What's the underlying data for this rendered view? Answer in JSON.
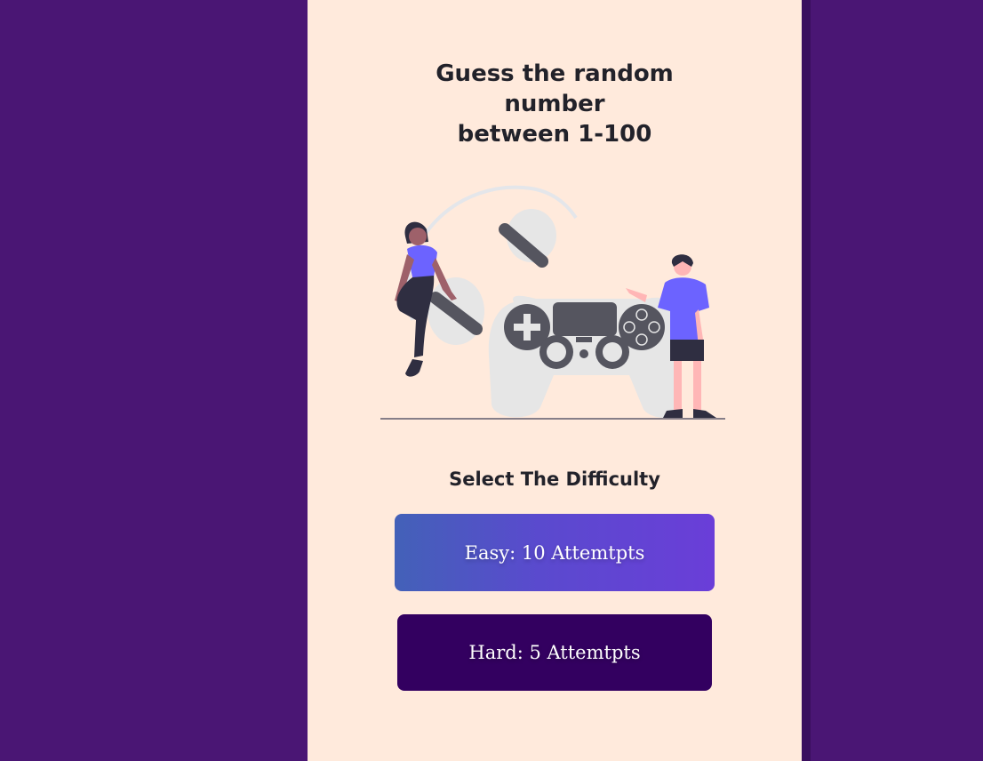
{
  "title_lines": [
    "Guess the random",
    "number",
    "between 1-100"
  ],
  "illustration": {
    "name": "gaming-illustration",
    "colors": {
      "accent": "#6c63ff",
      "controller": "#e6e6e6",
      "controller_dark": "#55555f",
      "skin": "#ffb6b6",
      "dark": "#2f2e41"
    }
  },
  "difficulty": {
    "heading": "Select The Difficulty",
    "easy_label": "Easy: 10 Attemtpts",
    "hard_label": "Hard: 5 Attemtpts"
  },
  "colors": {
    "background": "#4a1674",
    "panel": "#ffeadc",
    "text": "#22222a",
    "easy_gradient_start": "#4361b8",
    "easy_gradient_end": "#6a3ed8",
    "hard_button": "#330060"
  }
}
